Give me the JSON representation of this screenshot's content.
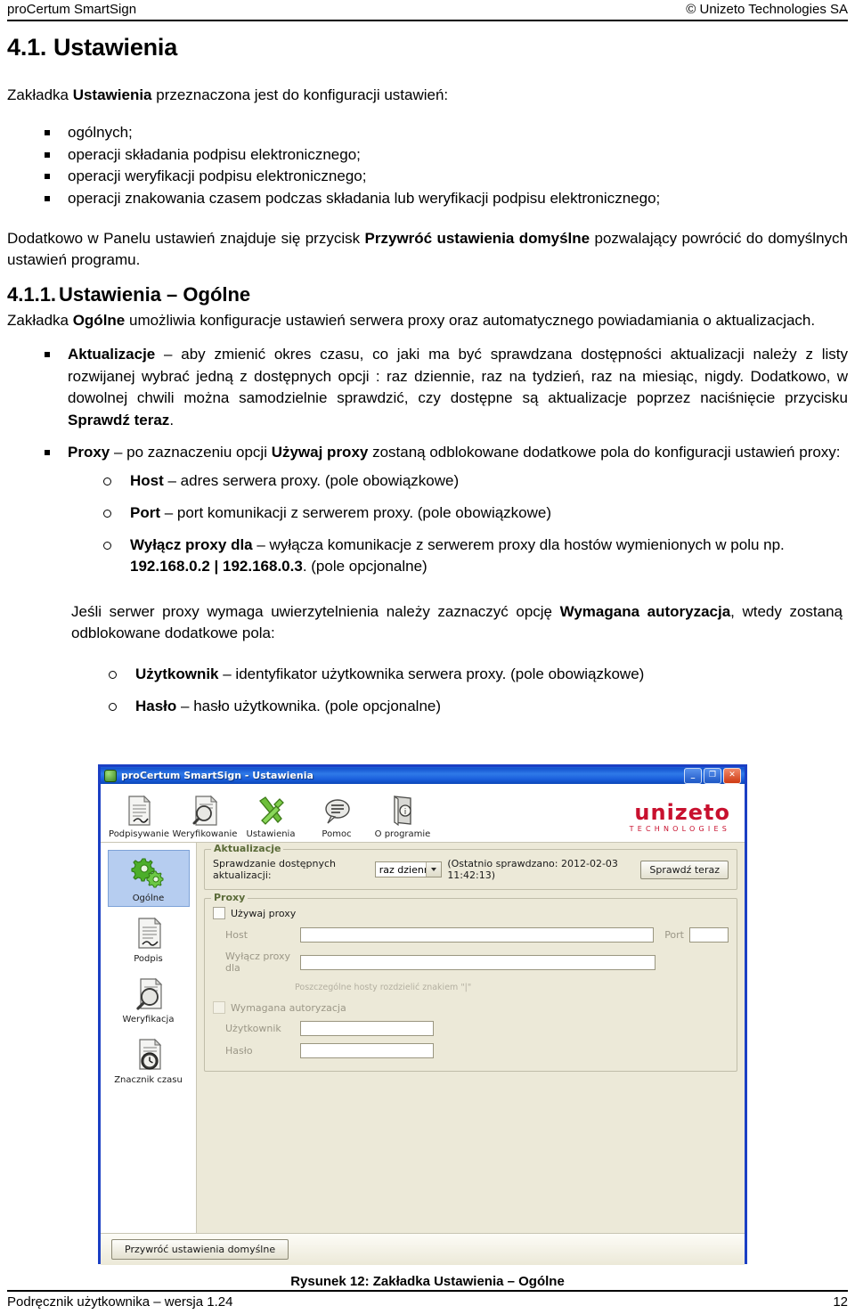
{
  "header": {
    "left": "proCertum SmartSign",
    "right": "© Unizeto Technologies SA"
  },
  "doc": {
    "section_number": "4.1.",
    "section_title": "Ustawienia",
    "lead": {
      "a": "Zakładka ",
      "b": "Ustawienia",
      "c": " przeznaczona jest do konfiguracji ustawień:"
    },
    "bullets": [
      "ogólnych;",
      "operacji składania podpisu elektronicznego;",
      "operacji weryfikacji podpisu elektronicznego;",
      "operacji znakowania czasem podczas składania lub weryfikacji podpisu elektronicznego;"
    ],
    "after_bullets": {
      "a": "Dodatkowo w Panelu ustawień znajduje się przycisk ",
      "b": "Przywróć ustawienia domyślne",
      "c": " pozwalający powrócić do domyślnych ustawień programu."
    },
    "subsection_number": "4.1.1.",
    "subsection_title": "Ustawienia – Ogólne",
    "sub_lead": {
      "a": "Zakładka ",
      "b": "Ogólne",
      "c": " umożliwia konfiguracje ustawień serwera proxy oraz automatycznego powiadamiania o aktualizacjach."
    },
    "item_updates": {
      "b1": "Aktualizacje",
      "t1": " – aby zmienić okres czasu, co jaki ma być sprawdzana dostępności aktualizacji należy z listy rozwijanej wybrać jedną z dostępnych opcji : raz dziennie, raz na tydzień, raz na miesiąc, nigdy. Dodatkowo, w dowolnej chwili można samodzielnie sprawdzić, czy dostępne są aktualizacje poprzez naciśnięcie przycisku ",
      "b2": "Sprawdź teraz",
      "t2": "."
    },
    "item_proxy": {
      "b1": "Proxy",
      "t1": " – po zaznaczeniu opcji ",
      "b2": "Używaj proxy",
      "t2": " zostaną odblokowane dodatkowe pola do konfiguracji ustawień proxy:"
    },
    "proxy_subitems": [
      {
        "b": "Host",
        "t": " – adres serwera proxy. (pole obowiązkowe)"
      },
      {
        "b": "Port",
        "t": " – port komunikacji z serwerem proxy. (pole obowiązkowe)"
      }
    ],
    "proxy_exclude": {
      "b1": "Wyłącz proxy dla",
      "t1": " – wyłącza komunikacje z serwerem proxy dla hostów wymienionych w polu np. ",
      "b2": "192.168.0.2 | 192.168.0.3",
      "t2": ". (pole opcjonalne)"
    },
    "auth_para": {
      "a": "Jeśli serwer proxy wymaga uwierzytelnienia należy zaznaczyć opcję ",
      "b": "Wymagana autoryzacja",
      "c": ", wtedy zostaną odblokowane dodatkowe pola:"
    },
    "auth_subitems": [
      {
        "b": "Użytkownik",
        "t": " – identyfikator użytkownika serwera proxy. (pole obowiązkowe)"
      },
      {
        "b": "Hasło",
        "t": " – hasło użytkownika. (pole opcjonalne)"
      }
    ],
    "figure_caption": "Rysunek 12: Zakładka Ustawienia – Ogólne"
  },
  "footer": {
    "left": "Podręcznik użytkownika – wersja 1.24",
    "page": "12"
  },
  "app": {
    "window_title": "proCertum SmartSign - Ustawienia",
    "window_buttons": {
      "minimize": "_",
      "maximize": "❐",
      "close": "✕"
    },
    "toolbar": [
      {
        "label": "Podpisywanie",
        "icon": "document-sign-icon"
      },
      {
        "label": "Weryfikowanie",
        "icon": "document-verify-icon"
      },
      {
        "label": "Ustawienia",
        "icon": "tools-icon"
      },
      {
        "label": "Pomoc",
        "icon": "help-balloon-icon"
      },
      {
        "label": "O programie",
        "icon": "about-book-icon"
      }
    ],
    "logo": {
      "word": "unizeto",
      "sub": "TECHNOLOGIES",
      "color": "#c8102e"
    },
    "sidebar": [
      {
        "label": "Ogólne",
        "icon": "gears-icon",
        "selected": true
      },
      {
        "label": "Podpis",
        "icon": "document-sign-icon",
        "selected": false
      },
      {
        "label": "Weryfikacja",
        "icon": "document-magnifier-icon",
        "selected": false
      },
      {
        "label": "Znacznik czasu",
        "icon": "document-clock-icon",
        "selected": false
      }
    ],
    "updates_group": {
      "title": "Aktualizacje",
      "check_label": "Sprawdzanie dostępnych aktualizacji:",
      "interval_value": "raz dziennie",
      "interval_options": [
        "raz dziennie",
        "raz na tydzień",
        "raz na miesiąc",
        "nigdy"
      ],
      "last_check": "(Ostatnio sprawdzano: 2012-02-03 11:42:13)",
      "check_now_button": "Sprawdź teraz"
    },
    "proxy_group": {
      "title": "Proxy",
      "use_proxy_label": "Używaj proxy",
      "use_proxy_checked": false,
      "host_label": "Host",
      "host_value": "",
      "port_label": "Port",
      "port_value": "",
      "exclude_label": "Wyłącz proxy dla",
      "exclude_value": "",
      "exclude_hint": "Poszczególne hosty rozdzielić znakiem \"|\"",
      "auth_label": "Wymagana autoryzacja",
      "auth_checked": false,
      "user_label": "Użytkownik",
      "user_value": "",
      "password_label": "Hasło",
      "password_value": ""
    },
    "restore_defaults_button": "Przywróć ustawienia domyślne"
  }
}
